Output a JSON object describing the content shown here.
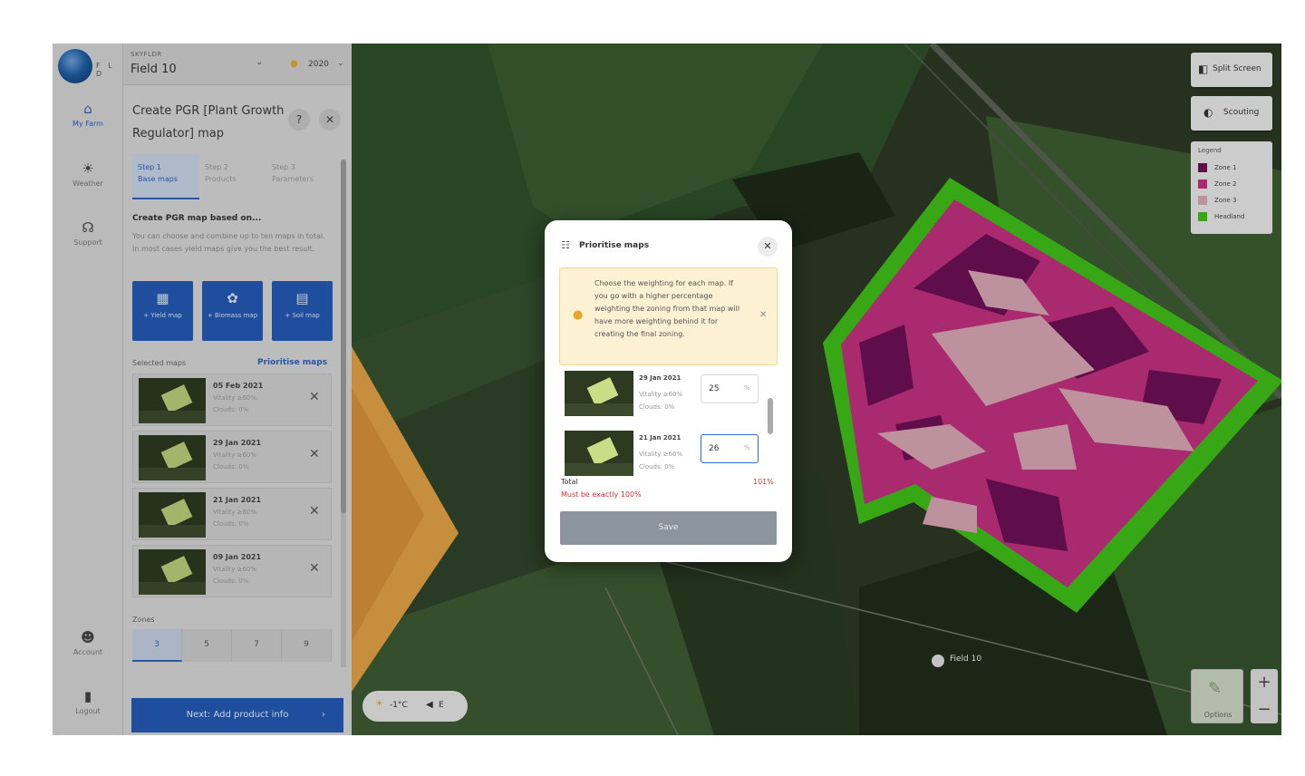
{
  "brand": {
    "logo_text": "F L D"
  },
  "rail": {
    "items": [
      {
        "icon": "home-icon",
        "glyph": "⌂",
        "label": "My Farm"
      },
      {
        "icon": "sun-icon",
        "glyph": "☀",
        "label": "Weather"
      },
      {
        "icon": "headset-icon",
        "glyph": "☊",
        "label": "Support"
      },
      {
        "icon": "account-icon",
        "glyph": "☻",
        "label": "Account"
      },
      {
        "icon": "logout-icon",
        "glyph": "▮",
        "label": "Logout"
      }
    ]
  },
  "topbar": {
    "farm_caption": "SKYFLDR",
    "field": "Field 10",
    "year": "2020"
  },
  "panel": {
    "title": "Create PGR [Plant Growth Regulator] map",
    "steps": [
      {
        "title": "Step 1",
        "sub": "Base maps"
      },
      {
        "title": "Step 2",
        "sub": "Products"
      },
      {
        "title": "Step 3",
        "sub": "Parameters"
      }
    ],
    "based_title": "Create PGR map based on...",
    "based_desc": "You can choose and combine up to ten maps in total. In most cases yield maps give you the best result.",
    "add_buttons": [
      {
        "icon": "yield-map-icon",
        "glyph": "▦",
        "label": "+ Yield map"
      },
      {
        "icon": "biomass-map-icon",
        "glyph": "✿",
        "label": "+ Biomass map"
      },
      {
        "icon": "soil-map-icon",
        "glyph": "▤",
        "label": "+ Soil map"
      }
    ],
    "selected_label": "Selected maps",
    "prioritise_link": "Prioritise maps",
    "maps": [
      {
        "date": "05 Feb 2021",
        "vitality": "Vitality ≥60%",
        "clouds": "Clouds: 0%"
      },
      {
        "date": "29 Jan 2021",
        "vitality": "Vitality ≥60%",
        "clouds": "Clouds: 0%"
      },
      {
        "date": "21 Jan 2021",
        "vitality": "Vitality ≥60%",
        "clouds": "Clouds: 0%"
      },
      {
        "date": "09 Jan 2021",
        "vitality": "Vitality ≥60%",
        "clouds": "Clouds: 0%"
      }
    ],
    "zones_label": "Zones",
    "zones": [
      "3",
      "5",
      "7",
      "9"
    ],
    "next_button": "Next: Add product info"
  },
  "map": {
    "split_screen": "Split Screen",
    "scouting": "Scouting",
    "legend": {
      "title": "Legend",
      "items": [
        {
          "label": "Zone 1",
          "color": "#6e0f57"
        },
        {
          "label": "Zone 2",
          "color": "#c2307f"
        },
        {
          "label": "Zone 3",
          "color": "#d9a6b4"
        },
        {
          "label": "Headland",
          "color": "#3fbf1a"
        }
      ]
    },
    "weather": {
      "temp": "-1°C",
      "wind": "E"
    },
    "field_label": "Field 10",
    "options_label": "Options",
    "zoom_in": "+",
    "zoom_out": "−"
  },
  "modal": {
    "title": "Prioritise maps",
    "info": "Choose the weighting for each map. If you go with a higher percentage weighting the zoning from that map will have more weighting behind it for creating the final zoning.",
    "rows": [
      {
        "date": "29 Jan 2021",
        "vitality": "Vitality ≥60%",
        "clouds": "Clouds: 0%",
        "value": "25",
        "unit": "%"
      },
      {
        "date": "21 Jan 2021",
        "vitality": "Vitality ≥60%",
        "clouds": "Clouds: 0%",
        "value": "26",
        "unit": "%"
      }
    ],
    "total_label": "Total",
    "total_value": "101%",
    "error": "Must be exactly 100%",
    "save": "Save"
  }
}
